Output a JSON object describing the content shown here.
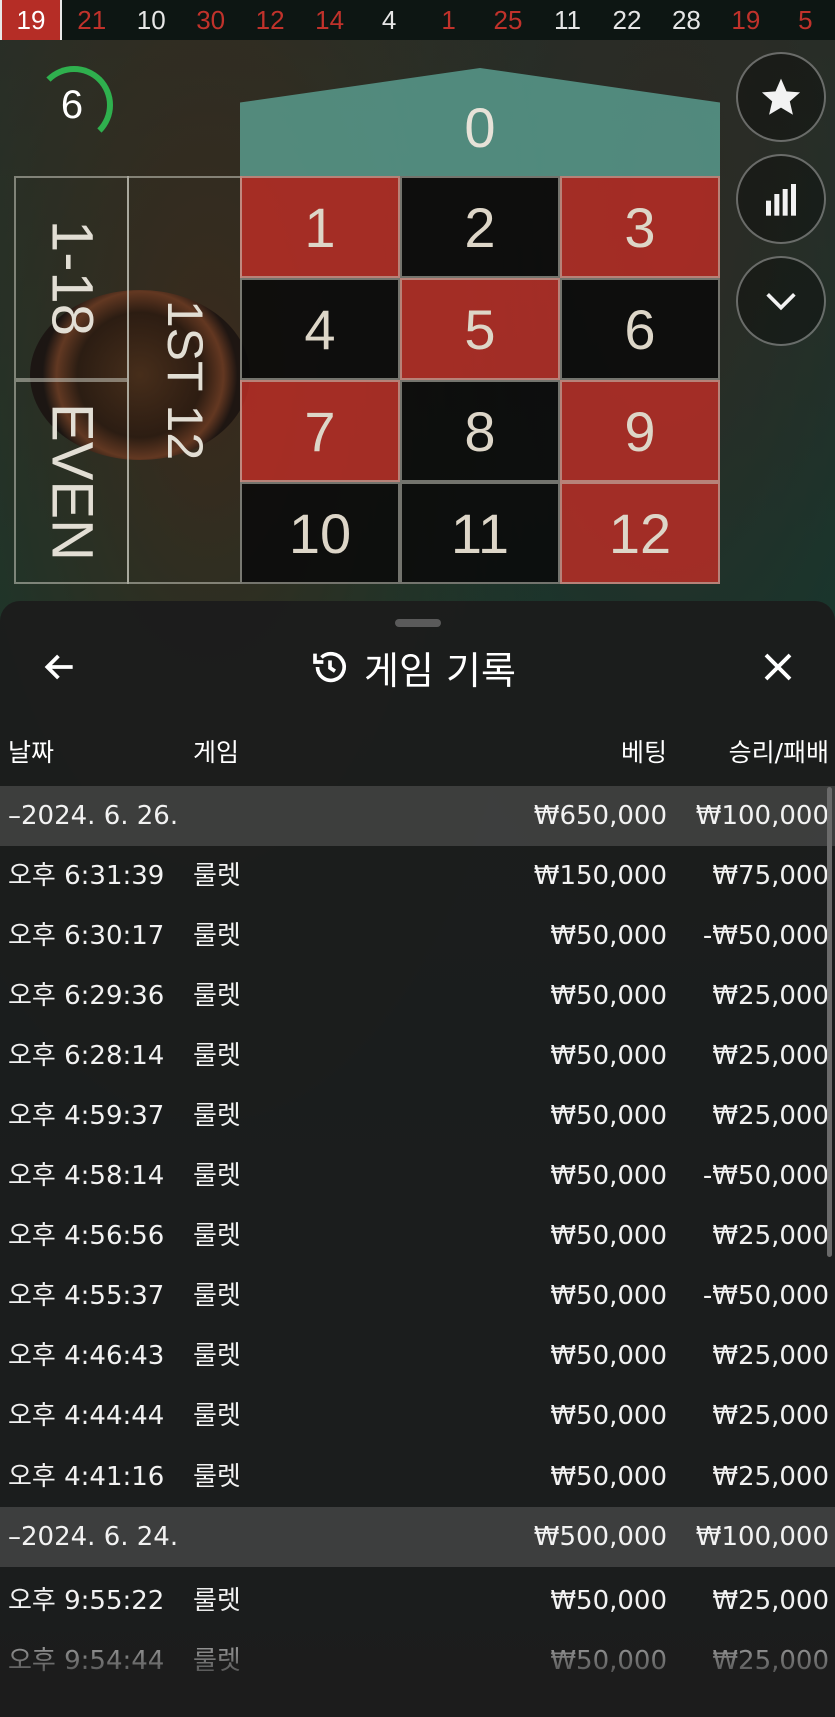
{
  "results_strip": [
    {
      "value": "19",
      "color": "red",
      "latest": true
    },
    {
      "value": "21",
      "color": "red"
    },
    {
      "value": "10",
      "color": "black"
    },
    {
      "value": "30",
      "color": "red"
    },
    {
      "value": "12",
      "color": "red"
    },
    {
      "value": "14",
      "color": "red"
    },
    {
      "value": "4",
      "color": "black"
    },
    {
      "value": "1",
      "color": "red"
    },
    {
      "value": "25",
      "color": "red"
    },
    {
      "value": "11",
      "color": "black"
    },
    {
      "value": "22",
      "color": "black"
    },
    {
      "value": "28",
      "color": "black"
    },
    {
      "value": "19",
      "color": "red"
    },
    {
      "value": "5",
      "color": "red"
    }
  ],
  "timer": {
    "value": "6"
  },
  "table": {
    "zero": "0",
    "low_label": "1-18",
    "even_label": "EVEN",
    "dozen_label": "1ST 12",
    "numbers": [
      {
        "n": "1",
        "c": "r"
      },
      {
        "n": "2",
        "c": "b"
      },
      {
        "n": "3",
        "c": "r"
      },
      {
        "n": "4",
        "c": "b"
      },
      {
        "n": "5",
        "c": "r"
      },
      {
        "n": "6",
        "c": "b"
      },
      {
        "n": "7",
        "c": "r"
      },
      {
        "n": "8",
        "c": "b"
      },
      {
        "n": "9",
        "c": "r"
      },
      {
        "n": "10",
        "c": "b"
      },
      {
        "n": "11",
        "c": "b"
      },
      {
        "n": "12",
        "c": "r"
      }
    ]
  },
  "side_buttons": [
    "star-icon",
    "stats-icon",
    "chevron-down-icon"
  ],
  "sheet": {
    "title": "게임 기록",
    "columns": {
      "date": "날짜",
      "game": "게임",
      "bet": "베팅",
      "winloss": "승리/패배"
    },
    "rows": [
      {
        "type": "group",
        "date": "–2024. 6. 26.",
        "game": "",
        "bet": "₩650,000",
        "result": "₩100,000"
      },
      {
        "type": "item",
        "date": "오후 6:31:39",
        "game": "룰렛",
        "bet": "₩150,000",
        "result": "₩75,000"
      },
      {
        "type": "item",
        "date": "오후 6:30:17",
        "game": "룰렛",
        "bet": "₩50,000",
        "result": "-₩50,000"
      },
      {
        "type": "item",
        "date": "오후 6:29:36",
        "game": "룰렛",
        "bet": "₩50,000",
        "result": "₩25,000"
      },
      {
        "type": "item",
        "date": "오후 6:28:14",
        "game": "룰렛",
        "bet": "₩50,000",
        "result": "₩25,000"
      },
      {
        "type": "item",
        "date": "오후 4:59:37",
        "game": "룰렛",
        "bet": "₩50,000",
        "result": "₩25,000"
      },
      {
        "type": "item",
        "date": "오후 4:58:14",
        "game": "룰렛",
        "bet": "₩50,000",
        "result": "-₩50,000"
      },
      {
        "type": "item",
        "date": "오후 4:56:56",
        "game": "룰렛",
        "bet": "₩50,000",
        "result": "₩25,000"
      },
      {
        "type": "item",
        "date": "오후 4:55:37",
        "game": "룰렛",
        "bet": "₩50,000",
        "result": "-₩50,000"
      },
      {
        "type": "item",
        "date": "오후 4:46:43",
        "game": "룰렛",
        "bet": "₩50,000",
        "result": "₩25,000"
      },
      {
        "type": "item",
        "date": "오후 4:44:44",
        "game": "룰렛",
        "bet": "₩50,000",
        "result": "₩25,000"
      },
      {
        "type": "item",
        "date": "오후 4:41:16",
        "game": "룰렛",
        "bet": "₩50,000",
        "result": "₩25,000"
      },
      {
        "type": "group",
        "date": "–2024. 6. 24.",
        "game": "",
        "bet": "₩500,000",
        "result": "₩100,000"
      },
      {
        "type": "item",
        "date": "오후 9:55:22",
        "game": "룰렛",
        "bet": "₩50,000",
        "result": "₩25,000"
      },
      {
        "type": "item",
        "date": "오후 9:54:44",
        "game": "룰렛",
        "bet": "₩50,000",
        "result": "₩25,000"
      }
    ]
  }
}
